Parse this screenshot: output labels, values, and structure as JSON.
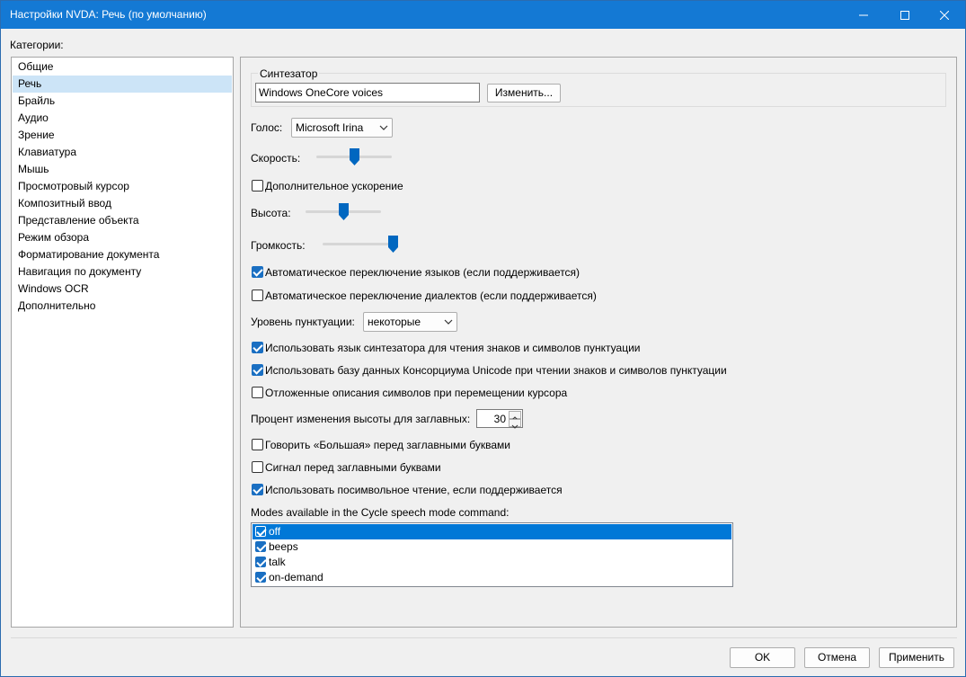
{
  "window": {
    "title": "Настройки NVDA: Речь (по умолчанию)",
    "minimize_icon": "minimize-icon",
    "maximize_icon": "maximize-icon",
    "close_icon": "close-icon"
  },
  "categories": {
    "label": "Категории:",
    "items": [
      {
        "label": "Общие",
        "selected": false
      },
      {
        "label": "Речь",
        "selected": true
      },
      {
        "label": "Брайль",
        "selected": false
      },
      {
        "label": "Аудио",
        "selected": false
      },
      {
        "label": "Зрение",
        "selected": false
      },
      {
        "label": "Клавиатура",
        "selected": false
      },
      {
        "label": "Мышь",
        "selected": false
      },
      {
        "label": "Просмотровый курсор",
        "selected": false
      },
      {
        "label": "Композитный ввод",
        "selected": false
      },
      {
        "label": "Представление объекта",
        "selected": false
      },
      {
        "label": "Режим обзора",
        "selected": false
      },
      {
        "label": "Форматирование документа",
        "selected": false
      },
      {
        "label": "Навигация по документу",
        "selected": false
      },
      {
        "label": "Windows OCR",
        "selected": false
      },
      {
        "label": "Дополнительно",
        "selected": false
      }
    ]
  },
  "synth": {
    "group_label": "Синтезатор",
    "value": "Windows OneCore voices",
    "change_button": "Изменить..."
  },
  "voice": {
    "label": "Голос:",
    "value": "Microsoft Irina"
  },
  "rate": {
    "label": "Скорость:",
    "level": 0.5
  },
  "rate_boost": {
    "label": "Дополнительное ускорение",
    "checked": false
  },
  "pitch": {
    "label": "Высота:",
    "level": 0.5
  },
  "volume": {
    "label": "Громкость:",
    "level": 1.0
  },
  "options_top": [
    {
      "label": "Автоматическое переключение языков (если поддерживается)",
      "checked": true
    },
    {
      "label": "Автоматическое переключение диалектов (если поддерживается)",
      "checked": false
    }
  ],
  "punctuation": {
    "label": "Уровень пунктуации:",
    "value": "некоторые"
  },
  "options_mid": [
    {
      "label": "Использовать язык синтезатора для чтения знаков и символов пунктуации",
      "checked": true
    },
    {
      "label": "Использовать базу данных Консорциума Unicode при чтении знаков и символов пунктуации",
      "checked": true
    },
    {
      "label": "Отложенные описания символов при перемещении курсора",
      "checked": false
    }
  ],
  "cap_pitch": {
    "label": "Процент изменения высоты для заглавных:",
    "value": "30"
  },
  "options_bottom": [
    {
      "label": "Говорить «Большая» перед заглавными буквами",
      "checked": false
    },
    {
      "label": "Сигнал перед заглавными буквами",
      "checked": false
    },
    {
      "label": "Использовать посимвольное чтение, если поддерживается",
      "checked": true
    }
  ],
  "modes": {
    "label": "Modes available in the Cycle speech mode command:",
    "items": [
      {
        "label": "off",
        "checked": true,
        "selected": true
      },
      {
        "label": "beeps",
        "checked": true,
        "selected": false
      },
      {
        "label": "talk",
        "checked": true,
        "selected": false
      },
      {
        "label": "on-demand",
        "checked": true,
        "selected": false
      }
    ]
  },
  "buttons": {
    "ok": "OK",
    "cancel": "Отмена",
    "apply": "Применить"
  },
  "colors": {
    "titlebar": "#1479d4",
    "accent": "#1a6fc2",
    "selection": "#cce4f7"
  }
}
